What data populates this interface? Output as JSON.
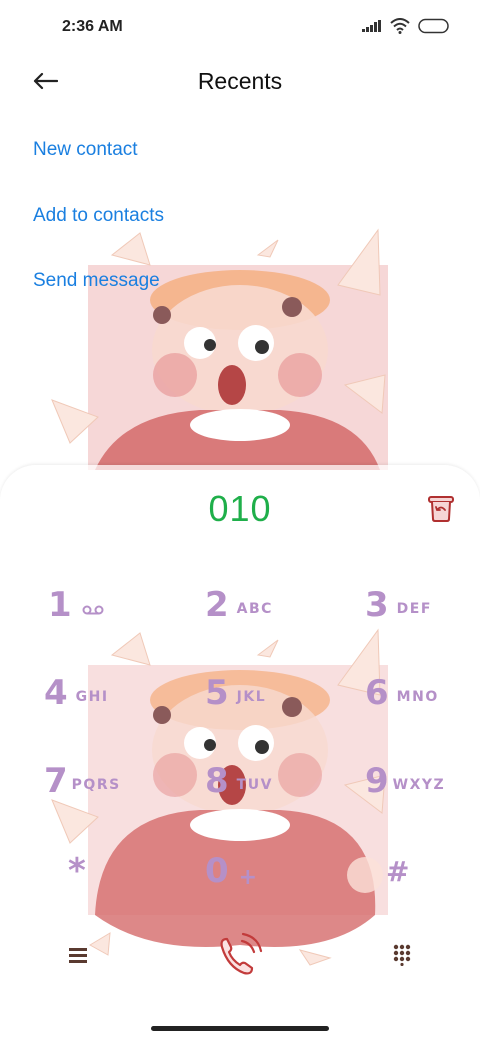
{
  "status_bar": {
    "time": "2:36 AM"
  },
  "header": {
    "title": "Recents"
  },
  "actions": {
    "new_contact": "New contact",
    "add_to_contacts": "Add to contacts",
    "send_message": "Send message"
  },
  "dialer": {
    "number": "010",
    "keys": [
      {
        "digit": "1",
        "letters": ""
      },
      {
        "digit": "2",
        "letters": "ABC"
      },
      {
        "digit": "3",
        "letters": "DEF"
      },
      {
        "digit": "4",
        "letters": "GHI"
      },
      {
        "digit": "5",
        "letters": "JKL"
      },
      {
        "digit": "6",
        "letters": "MNO"
      },
      {
        "digit": "7",
        "letters": "PQRS"
      },
      {
        "digit": "8",
        "letters": "TUV"
      },
      {
        "digit": "9",
        "letters": "WXYZ"
      },
      {
        "digit": "*",
        "letters": ""
      },
      {
        "digit": "0",
        "letters": "+"
      },
      {
        "digit": "#",
        "letters": ""
      }
    ]
  },
  "icons": {
    "back": "back-arrow-icon",
    "clear": "clear-trash-icon",
    "voicemail": "voicemail-icon",
    "menu": "menu-icon",
    "call": "call-icon",
    "keypad": "keypad-icon"
  },
  "colors": {
    "link": "#1a7fe0",
    "number": "#1faf4a",
    "key": "#b590c8",
    "call_icon": "#c23b3b"
  }
}
